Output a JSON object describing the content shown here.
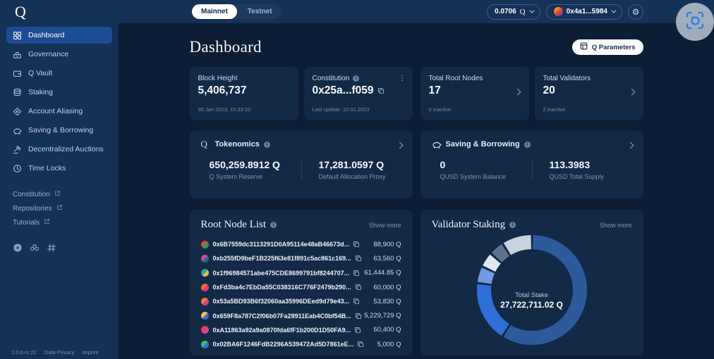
{
  "topbar": {
    "logo": "Q",
    "network_tabs": [
      {
        "label": "Mainnet",
        "active": true
      },
      {
        "label": "Testnet",
        "active": false
      }
    ],
    "balance": {
      "value": "0.0706",
      "unit": "Q"
    },
    "wallet": {
      "address": "0x4a1...5984"
    }
  },
  "sidebar": {
    "items": [
      {
        "label": "Dashboard",
        "icon": "grid-icon",
        "active": true
      },
      {
        "label": "Governance",
        "icon": "ballot-icon",
        "active": false
      },
      {
        "label": "Q Vault",
        "icon": "wallet-icon",
        "active": false
      },
      {
        "label": "Staking",
        "icon": "coins-icon",
        "active": false
      },
      {
        "label": "Account Aliasing",
        "icon": "tag-icon",
        "active": false
      },
      {
        "label": "Saving & Borrowing",
        "icon": "piggy-bank-icon",
        "active": false
      },
      {
        "label": "Decentralized Auctions",
        "icon": "gavel-icon",
        "active": false
      },
      {
        "label": "Time Locks",
        "icon": "clock-icon",
        "active": false
      }
    ],
    "links": [
      "Constitution",
      "Repositories",
      "Tutorials"
    ],
    "social_icons": [
      "medium-icon",
      "binoculars-icon",
      "hash-icon"
    ],
    "footer": {
      "version": "1.0.0-rc.22",
      "privacy": "Data Privacy",
      "imprint": "Imprint"
    }
  },
  "main": {
    "title": "Dashboard",
    "q_parameters_label": "Q Parameters",
    "stat_cards": [
      {
        "label": "Block Height",
        "value": "5,406,737",
        "sub": "30 Jan 2023, 15:33:10"
      },
      {
        "label": "Constitution",
        "value": "0x25a...f059",
        "sub": "Last update: 10.01.2023"
      },
      {
        "label": "Total Root Nodes",
        "value": "17",
        "sub": "0 inactive"
      },
      {
        "label": "Total Validators",
        "value": "20",
        "sub": "2 inactive"
      }
    ],
    "tokenomics": {
      "title": "Tokenomics",
      "metrics": [
        {
          "value": "650,259.8912 Q",
          "label": "Q System Reserve"
        },
        {
          "value": "17,281.0597 Q",
          "label": "Default Allocation Proxy"
        }
      ]
    },
    "saving": {
      "title": "Saving & Borrowing",
      "metrics": [
        {
          "value": "0",
          "label": "QUSD System Balance"
        },
        {
          "value": "113.3983",
          "label": "QUSD Total Supply"
        }
      ]
    },
    "root_node_list": {
      "title": "Root Node List",
      "show_more": "Show more",
      "rows": [
        {
          "address": "0x6B7559dc3113291D0A95114e48aB46673d...",
          "amount": "88,900 Q",
          "avatar": [
            "#e2483d",
            "#1f9e63"
          ]
        },
        {
          "address": "0xb255fD9beF1B225f63e81f891c5ac861c169...",
          "amount": "63,560 Q",
          "avatar": [
            "#d8439b",
            "#14707e"
          ]
        },
        {
          "address": "0x1f96984571abe475CDE8699791bf8244707...",
          "amount": "61,444.85 Q",
          "avatar": [
            "#27a39b",
            "#e3b93c"
          ]
        },
        {
          "address": "0xFd3ba4c7EbDa55C038316C776F2479b290...",
          "amount": "60,000 Q",
          "avatar": [
            "#f0692e",
            "#e4307f"
          ]
        },
        {
          "address": "0x53a5BD93B6f32060aa35996DEed9d79e43...",
          "amount": "53,830 Q",
          "avatar": [
            "#ef7d35",
            "#cf3f8f"
          ]
        },
        {
          "address": "0x659F8a787C2f06b07Fa28911Eab4C0bf54B...",
          "amount": "5,229,729 Q",
          "avatar": [
            "#f0c23c",
            "#3b67d8"
          ]
        },
        {
          "address": "0xA11863a92a9a0870fda6fF1b200D1D50FA9...",
          "amount": "50,400 Q",
          "avatar": [
            "#ef3d4e",
            "#d8439b"
          ]
        },
        {
          "address": "0x02BA6F1246FdB2296A539472Ad5D7861eE...",
          "amount": "5,000 Q",
          "avatar": [
            "#41c06a",
            "#2f6fd6"
          ]
        }
      ]
    },
    "validator_staking": {
      "title": "Validator Staking",
      "show_more": "Show more"
    }
  },
  "chart_data": {
    "type": "pie",
    "title": "Validator Staking",
    "center_label": "Total Stake",
    "center_value": "27,722,711.02 Q",
    "series": [
      {
        "name": "stake-segment-1",
        "share_pct": 59,
        "color": "#2c5a9a"
      },
      {
        "name": "stake-segment-2",
        "share_pct": 18,
        "color": "#2f70d8"
      },
      {
        "name": "stake-segment-3",
        "share_pct": 5,
        "color": "#6f9be2"
      },
      {
        "name": "stake-segment-4",
        "share_pct": 4.5,
        "color": "#dfe7f2"
      },
      {
        "name": "stake-segment-5",
        "share_pct": 4.5,
        "color": "#5d7490"
      },
      {
        "name": "stake-segment-6",
        "share_pct": 9,
        "color": "#c7d2e0"
      }
    ]
  }
}
